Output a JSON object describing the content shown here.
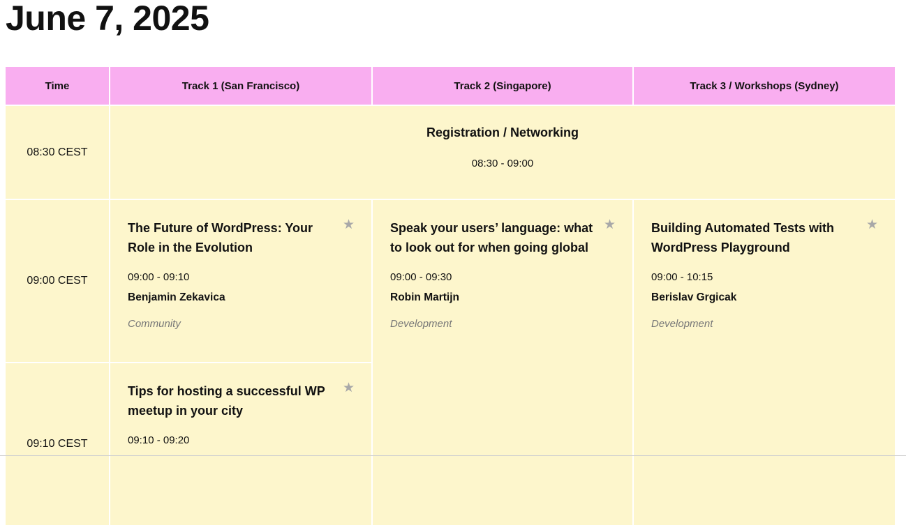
{
  "page": {
    "title": "June 7, 2025"
  },
  "schedule": {
    "headers": {
      "time": "Time",
      "track1": "Track 1 (San Francisco)",
      "track2": "Track 2 (Singapore)",
      "track3": "Track 3 / Workshops (Sydney)"
    },
    "slots": [
      {
        "time": "08:30 CEST"
      },
      {
        "time": "09:00 CEST"
      },
      {
        "time": "09:10 CEST"
      }
    ],
    "registration": {
      "title": "Registration / Networking",
      "time": "08:30 - 09:00"
    },
    "sessions": [
      {
        "title": "The Future of WordPress: Your Role in the Evolution",
        "time": "09:00 - 09:10",
        "speaker": "Benjamin Zekavica",
        "category": "Community",
        "star": "★"
      },
      {
        "title": "Speak your users’ language: what to look out for when going global",
        "time": "09:00 - 09:30",
        "speaker": "Robin Martijn",
        "category": "Development",
        "star": "★"
      },
      {
        "title": "Building Automated Tests with WordPress Playground",
        "time": "09:00 - 10:15",
        "speaker": "Berislav Grgicak",
        "category": "Development",
        "star": "★"
      },
      {
        "title": "Tips for hosting a successful WP meetup in your city",
        "time": "09:10 - 09:20",
        "star": "★"
      }
    ]
  },
  "colors": {
    "header_bg": "#f9aef0",
    "cell_bg": "#fdf6cc",
    "category_text": "#777777",
    "star": "#a8a8a8"
  },
  "icons": {
    "favorite": "star-icon"
  }
}
